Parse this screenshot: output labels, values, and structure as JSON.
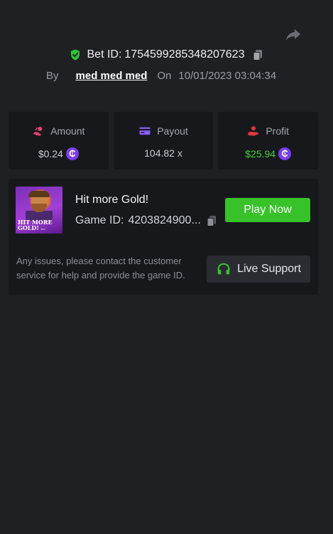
{
  "header": {
    "bet_label": "Bet ID:",
    "bet_id": "1754599285348207623",
    "by_label": "By",
    "username": "med med med",
    "on_label": "On",
    "date": "10/01/2023 03:04:34"
  },
  "stats": {
    "amount": {
      "label": "Amount",
      "value": "$0.24",
      "currency_icon": "coin-icon"
    },
    "payout": {
      "label": "Payout",
      "value": "104.82 x"
    },
    "profit": {
      "label": "Profit",
      "value": "$25.94",
      "currency_icon": "coin-icon"
    }
  },
  "game": {
    "name": "Hit more Gold!",
    "id_label": "Game ID:",
    "id_value": "4203824900...",
    "thumb_title_line1": "HIT MORE",
    "thumb_title_line2": "GOLD!",
    "thumb_brand": "1x2",
    "play_label": "Play Now"
  },
  "support": {
    "text": "Any issues, please contact the customer service for help and provide the game ID.",
    "button_label": "Live Support"
  },
  "colors": {
    "background": "#1f2024",
    "card": "#17181c",
    "accent_green": "#37c22a",
    "profit_green": "#3fd13a",
    "coin_purple": "#7b3cf0",
    "amount_icon": "#e8416b",
    "payout_icon": "#8b5cf6",
    "profit_icon": "#e03a3a"
  }
}
